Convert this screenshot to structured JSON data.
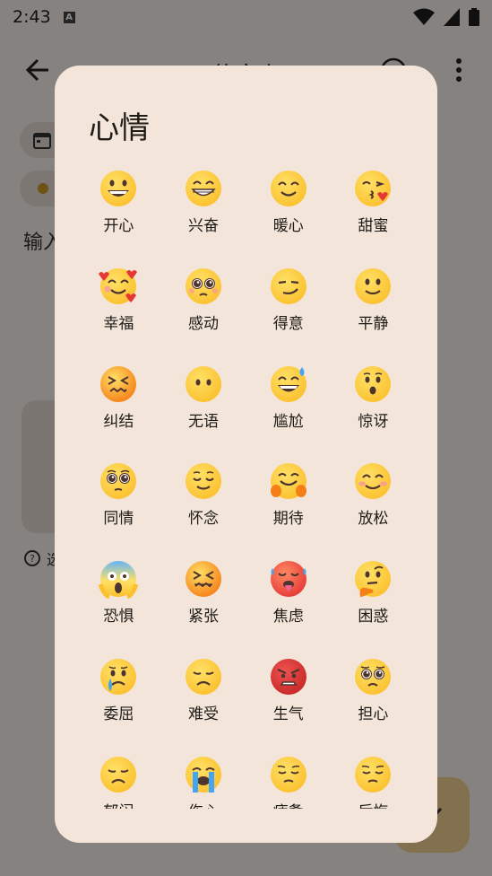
{
  "status_bar": {
    "time": "2:43",
    "notif_badge": "A"
  },
  "toolbar": {
    "title": "使文上"
  },
  "background": {
    "input_placeholder": "输入",
    "tip_text": "选"
  },
  "dialog": {
    "title": "心情",
    "moods": [
      {
        "label": "开心",
        "icon": "grinning-face-icon"
      },
      {
        "label": "兴奋",
        "icon": "beaming-face-icon"
      },
      {
        "label": "暖心",
        "icon": "smiling-face-icon"
      },
      {
        "label": "甜蜜",
        "icon": "kissing-face-icon"
      },
      {
        "label": "幸福",
        "icon": "smiling-face-with-hearts-icon"
      },
      {
        "label": "感动",
        "icon": "pleading-face-icon"
      },
      {
        "label": "得意",
        "icon": "smirking-face-icon"
      },
      {
        "label": "平静",
        "icon": "slightly-smiling-face-icon"
      },
      {
        "label": "纠结",
        "icon": "confounded-face-icon"
      },
      {
        "label": "无语",
        "icon": "face-without-mouth-icon"
      },
      {
        "label": "尴尬",
        "icon": "grinning-sweat-face-icon"
      },
      {
        "label": "惊讶",
        "icon": "hushed-face-icon"
      },
      {
        "label": "同情",
        "icon": "pleading-eyes-icon"
      },
      {
        "label": "怀念",
        "icon": "relieved-face-icon"
      },
      {
        "label": "期待",
        "icon": "hugging-face-icon"
      },
      {
        "label": "放松",
        "icon": "blushing-face-icon"
      },
      {
        "label": "恐惧",
        "icon": "screaming-face-icon"
      },
      {
        "label": "紧张",
        "icon": "tense-face-icon"
      },
      {
        "label": "焦虑",
        "icon": "hot-face-icon"
      },
      {
        "label": "困惑",
        "icon": "thinking-face-icon"
      },
      {
        "label": "委屈",
        "icon": "crying-face-icon"
      },
      {
        "label": "难受",
        "icon": "disappointed-face-icon"
      },
      {
        "label": "生气",
        "icon": "angry-face-icon"
      },
      {
        "label": "担心",
        "icon": "worried-face-icon"
      },
      {
        "label": "郁闷",
        "icon": "disappointed-face-icon"
      },
      {
        "label": "伤心",
        "icon": "loudly-crying-face-icon"
      },
      {
        "label": "疲惫",
        "icon": "pensive-face-icon"
      },
      {
        "label": "后悔",
        "icon": "pensive-face-icon"
      }
    ]
  },
  "colors": {
    "scrim": "#000000",
    "dialog_bg": "#f3e5da",
    "emoji_yellow": "#fbc02d",
    "emoji_red": "#e53935",
    "fab": "#f0cf92"
  }
}
